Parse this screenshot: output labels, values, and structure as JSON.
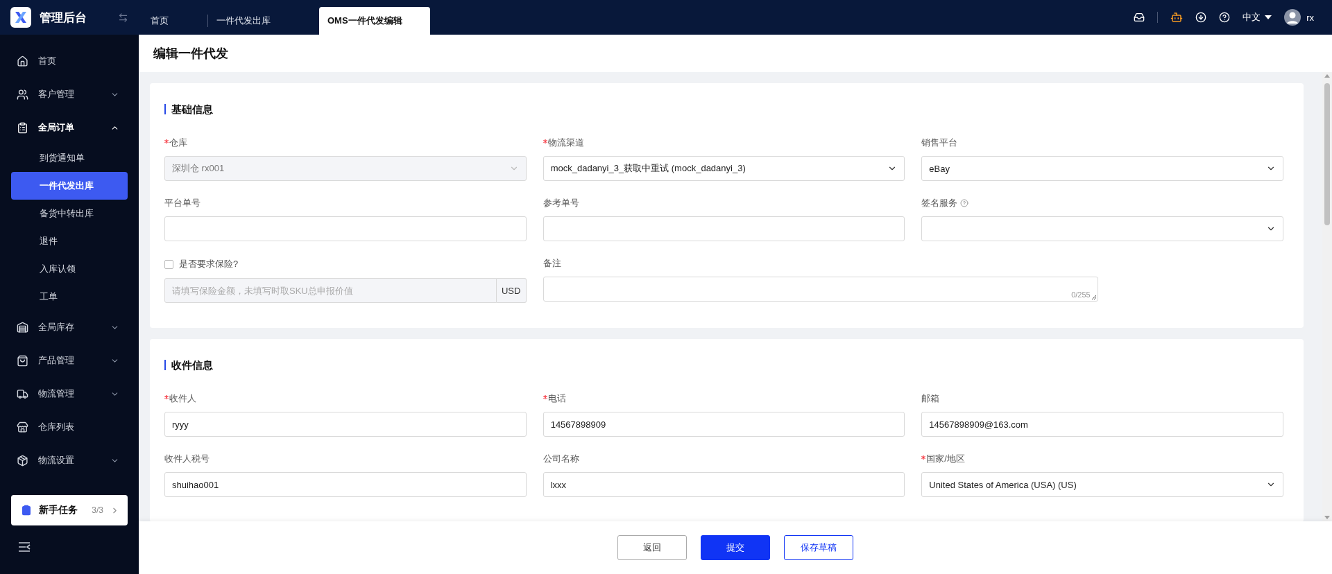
{
  "app": {
    "title": "管理后台"
  },
  "tabs": [
    {
      "label": "首页",
      "selected": false
    },
    {
      "label": "一件代发出库",
      "selected": false
    },
    {
      "label": "OMS一件代发编辑",
      "selected": true
    }
  ],
  "header": {
    "language": "中文",
    "user": "rx"
  },
  "sidebar": {
    "items": [
      {
        "label": "首页",
        "kind": "link"
      },
      {
        "label": "客户管理",
        "kind": "group",
        "expanded": false
      },
      {
        "label": "全局订单",
        "kind": "group",
        "expanded": true,
        "children": [
          {
            "label": "到货通知单",
            "selected": false
          },
          {
            "label": "一件代发出库",
            "selected": true
          },
          {
            "label": "备货中转出库",
            "selected": false
          },
          {
            "label": "退件",
            "selected": false
          },
          {
            "label": "入库认领",
            "selected": false
          },
          {
            "label": "工单",
            "selected": false
          }
        ]
      },
      {
        "label": "全局库存",
        "kind": "group",
        "expanded": false
      },
      {
        "label": "产品管理",
        "kind": "group",
        "expanded": false
      },
      {
        "label": "物流管理",
        "kind": "group",
        "expanded": false
      },
      {
        "label": "仓库列表",
        "kind": "link"
      },
      {
        "label": "物流设置",
        "kind": "group",
        "expanded": false
      }
    ],
    "task_card": {
      "label": "新手任务",
      "count": "3/3"
    }
  },
  "page_title": "编辑一件代发",
  "sections": [
    {
      "title": "基础信息",
      "fields": [
        {
          "kind": "select",
          "label": "仓库",
          "required": true,
          "value": "深圳仓 rx001",
          "disabled": true
        },
        {
          "kind": "select",
          "label": "物流渠道",
          "required": true,
          "value": "mock_dadanyi_3_获取中重试 (mock_dadanyi_3)",
          "disabled": false
        },
        {
          "kind": "select",
          "label": "销售平台",
          "required": false,
          "value": "eBay",
          "disabled": false
        },
        {
          "kind": "input",
          "label": "平台单号",
          "required": false
        },
        {
          "kind": "input",
          "label": "参考单号",
          "required": false
        },
        {
          "kind": "select",
          "label": "签名服务",
          "required": false,
          "help": true,
          "disabled": false
        },
        {
          "kind": "money",
          "label": "是否要求保险?",
          "checked": false,
          "placeholder": "请填写保险金额，未填写时取SKU总申报价值",
          "unit": "USD",
          "disabled": true
        },
        {
          "kind": "textarea",
          "label": "备注",
          "required": false,
          "counter": "0/255"
        }
      ]
    },
    {
      "title": "收件信息",
      "fields": [
        {
          "kind": "input",
          "label": "收件人",
          "required": true,
          "value": "ryyy"
        },
        {
          "kind": "input",
          "label": "电话",
          "required": true,
          "value": "14567898909"
        },
        {
          "kind": "input",
          "label": "邮箱",
          "required": false,
          "value": "14567898909@163.com"
        },
        {
          "kind": "input",
          "label": "收件人税号",
          "required": false,
          "value": "shuihao001"
        },
        {
          "kind": "input",
          "label": "公司名称",
          "required": false,
          "value": "lxxx"
        },
        {
          "kind": "select",
          "label": "国家/地区",
          "required": true,
          "value": "United States of America (USA) (US)",
          "disabled": false
        }
      ]
    }
  ],
  "footer_buttons": [
    {
      "label": "返回",
      "kind": "default"
    },
    {
      "label": "提交",
      "kind": "primary"
    },
    {
      "label": "保存草稿",
      "kind": "outline"
    }
  ]
}
